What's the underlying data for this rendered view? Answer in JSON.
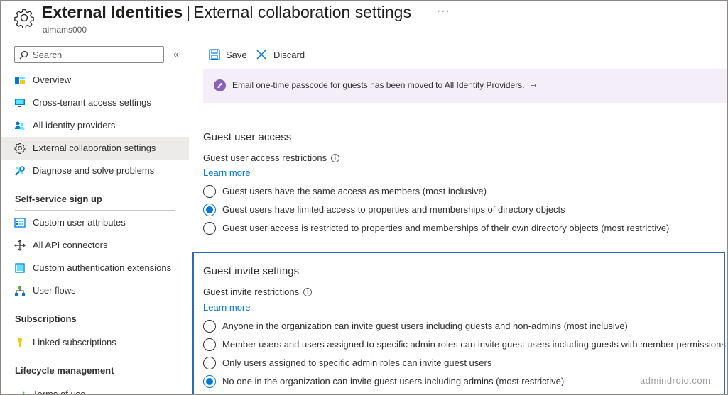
{
  "header": {
    "title_bold": "External Identities",
    "separator": "|",
    "title_sub": "External collaboration settings",
    "more": "···",
    "tenant": "aimams000"
  },
  "sidebar": {
    "search_placeholder": "Search",
    "collapse": "«",
    "items_top": [
      {
        "label": "Overview",
        "icon": "overview-icon"
      },
      {
        "label": "Cross-tenant access settings",
        "icon": "monitor-icon"
      },
      {
        "label": "All identity providers",
        "icon": "people-icon"
      },
      {
        "label": "External collaboration settings",
        "icon": "gear-icon",
        "active": true
      },
      {
        "label": "Diagnose and solve problems",
        "icon": "wrench-icon"
      }
    ],
    "section_selfservice": "Self-service sign up",
    "items_selfservice": [
      {
        "label": "Custom user attributes",
        "icon": "attributes-icon"
      },
      {
        "label": "All API connectors",
        "icon": "connectors-icon"
      },
      {
        "label": "Custom authentication extensions",
        "icon": "extensions-icon"
      },
      {
        "label": "User flows",
        "icon": "userflows-icon"
      }
    ],
    "section_subscriptions": "Subscriptions",
    "items_subscriptions": [
      {
        "label": "Linked subscriptions",
        "icon": "key-icon"
      }
    ],
    "section_lifecycle": "Lifecycle management",
    "items_lifecycle": [
      {
        "label": "Terms of use",
        "icon": "terms-icon"
      }
    ]
  },
  "toolbar": {
    "save_label": "Save",
    "discard_label": "Discard"
  },
  "banner": {
    "text": "Email one-time passcode for guests has been moved to All Identity Providers.",
    "arrow": "→"
  },
  "guest_access": {
    "heading": "Guest user access",
    "restrictions_label": "Guest user access restrictions",
    "info": "i",
    "learn_more": "Learn more",
    "options": [
      {
        "label": "Guest users have the same access as members (most inclusive)",
        "selected": false
      },
      {
        "label": "Guest users have limited access to properties and memberships of directory objects",
        "selected": true
      },
      {
        "label": "Guest user access is restricted to properties and memberships of their own directory objects (most restrictive)",
        "selected": false
      }
    ]
  },
  "guest_invite": {
    "heading": "Guest invite settings",
    "restrictions_label": "Guest invite restrictions",
    "info": "i",
    "learn_more": "Learn more",
    "options": [
      {
        "label": "Anyone in the organization can invite guest users including guests and non-admins (most inclusive)",
        "selected": false
      },
      {
        "label": "Member users and users assigned to specific admin roles can invite guest users including guests with member permissions",
        "selected": false
      },
      {
        "label": "Only users assigned to specific admin roles can invite guest users",
        "selected": false
      },
      {
        "label": "No one in the organization can invite guest users including admins (most restrictive)",
        "selected": true
      }
    ]
  },
  "watermark": "admindroid.com",
  "colors": {
    "accent": "#0078d4",
    "active_nav": "#edebe9",
    "banner_bg": "#f3eef8",
    "focus_border": "#2b6cb0"
  }
}
